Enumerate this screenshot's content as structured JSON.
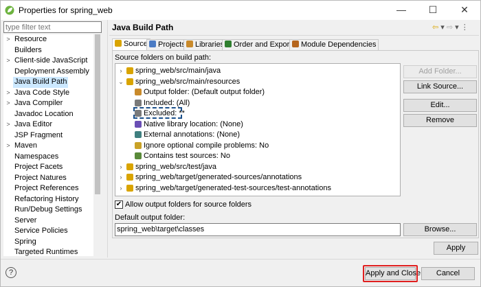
{
  "window": {
    "title": "Properties for spring_web",
    "minimize": "—",
    "maximize": "☐",
    "close": "✕"
  },
  "filter": {
    "placeholder": "type filter text"
  },
  "nav_items": [
    {
      "label": "Resource",
      "arrow": ">"
    },
    {
      "label": "Builders",
      "arrow": ""
    },
    {
      "label": "Client-side JavaScript",
      "arrow": ">"
    },
    {
      "label": "Deployment Assembly",
      "arrow": ""
    },
    {
      "label": "Java Build Path",
      "arrow": ""
    },
    {
      "label": "Java Code Style",
      "arrow": ">"
    },
    {
      "label": "Java Compiler",
      "arrow": ">"
    },
    {
      "label": "Javadoc Location",
      "arrow": ""
    },
    {
      "label": "Java Editor",
      "arrow": ">"
    },
    {
      "label": "JSP Fragment",
      "arrow": ""
    },
    {
      "label": "Maven",
      "arrow": ">"
    },
    {
      "label": "Namespaces",
      "arrow": ""
    },
    {
      "label": "Project Facets",
      "arrow": ""
    },
    {
      "label": "Project Natures",
      "arrow": ""
    },
    {
      "label": "Project References",
      "arrow": ""
    },
    {
      "label": "Refactoring History",
      "arrow": ""
    },
    {
      "label": "Run/Debug Settings",
      "arrow": ""
    },
    {
      "label": "Server",
      "arrow": ""
    },
    {
      "label": "Service Policies",
      "arrow": ""
    },
    {
      "label": "Spring",
      "arrow": ""
    },
    {
      "label": "Targeted Runtimes",
      "arrow": ""
    }
  ],
  "page_title": "Java Build Path",
  "tabs": [
    {
      "label": "Source"
    },
    {
      "label": "Projects"
    },
    {
      "label": "Libraries"
    },
    {
      "label": "Order and Export"
    },
    {
      "label": "Module Dependencies"
    }
  ],
  "source_label": "Source folders on build path:",
  "source_tree": [
    {
      "label": "spring_web/src/main/java",
      "arrow": ">",
      "level": 0,
      "icon": "package-folder-icon"
    },
    {
      "label": "spring_web/src/main/resources",
      "arrow": "v",
      "level": 0,
      "icon": "package-folder-icon"
    },
    {
      "label": "Output folder: (Default output folder)",
      "arrow": "",
      "level": 1,
      "icon": "output-folder-icon"
    },
    {
      "label": "Included: (All)",
      "arrow": "",
      "level": 1,
      "icon": "include-filter-icon"
    },
    {
      "label": "Excluded: **",
      "arrow": "",
      "level": 1,
      "icon": "exclude-filter-icon"
    },
    {
      "label": "Native library location: (None)",
      "arrow": "",
      "level": 1,
      "icon": "native-library-icon"
    },
    {
      "label": "External annotations: (None)",
      "arrow": "",
      "level": 1,
      "icon": "annotations-icon"
    },
    {
      "label": "Ignore optional compile problems: No",
      "arrow": "",
      "level": 1,
      "icon": "ignore-problems-icon"
    },
    {
      "label": "Contains test sources: No",
      "arrow": "",
      "level": 1,
      "icon": "test-sources-icon"
    },
    {
      "label": "spring_web/src/test/java",
      "arrow": ">",
      "level": 0,
      "icon": "package-folder-icon"
    },
    {
      "label": "spring_web/target/generated-sources/annotations",
      "arrow": ">",
      "level": 0,
      "icon": "package-folder-icon"
    },
    {
      "label": "spring_web/target/generated-test-sources/test-annotations",
      "arrow": ">",
      "level": 0,
      "icon": "package-folder-icon"
    }
  ],
  "buttons": {
    "add_folder": "Add Folder...",
    "link_source": "Link Source...",
    "edit": "Edit...",
    "remove": "Remove",
    "browse": "Browse...",
    "apply": "Apply",
    "apply_close": "Apply and Close",
    "cancel": "Cancel"
  },
  "allow_output": {
    "label": "Allow output folders for source folders",
    "checked": true
  },
  "default_output": {
    "label": "Default output folder:",
    "value": "spring_web\\target\\classes"
  },
  "colors": {
    "selection": "#cce8ff",
    "highlight_box": "#e01e1e",
    "focus_dash": "#1a4f8a"
  }
}
